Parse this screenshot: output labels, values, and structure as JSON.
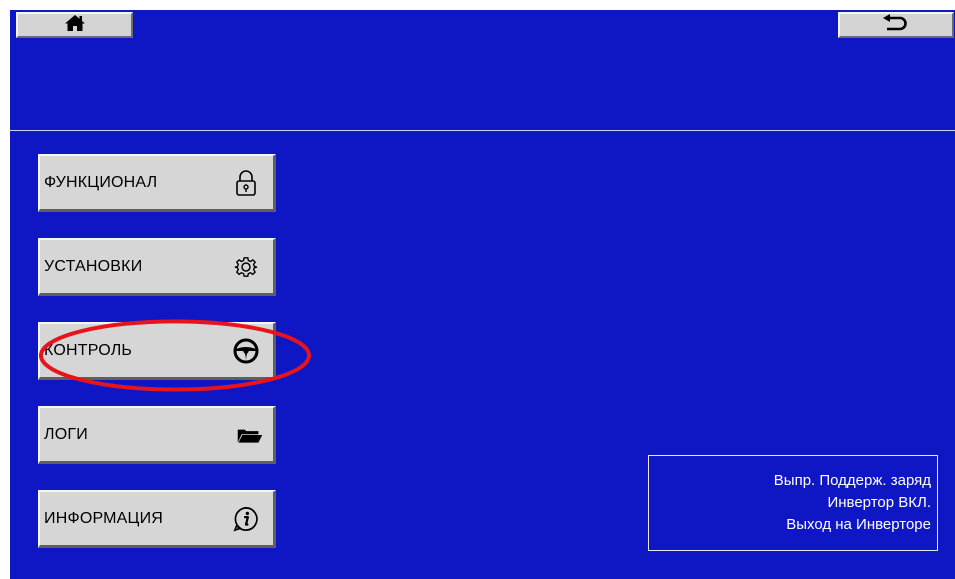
{
  "header": {
    "home_icon": "home-icon",
    "back_icon": "return-arrow-icon"
  },
  "menu": {
    "items": [
      {
        "label": "ФУНКЦИОНАЛ",
        "icon": "lock-icon"
      },
      {
        "label": "УСТАНОВКИ",
        "icon": "gear-icon"
      },
      {
        "label": "КОНТРОЛЬ",
        "icon": "steering-wheel-icon"
      },
      {
        "label": "ЛОГИ",
        "icon": "folder-icon"
      },
      {
        "label": "ИНФОРМАЦИЯ",
        "icon": "info-icon"
      }
    ]
  },
  "status": {
    "lines": [
      "Выпр. Поддерж. заряд",
      "Инвертор ВКЛ.",
      "Выход на Инверторе"
    ]
  },
  "colors": {
    "background": "#0F17C4",
    "button_face": "#D6D6D6",
    "highlight": "#E8141B"
  }
}
